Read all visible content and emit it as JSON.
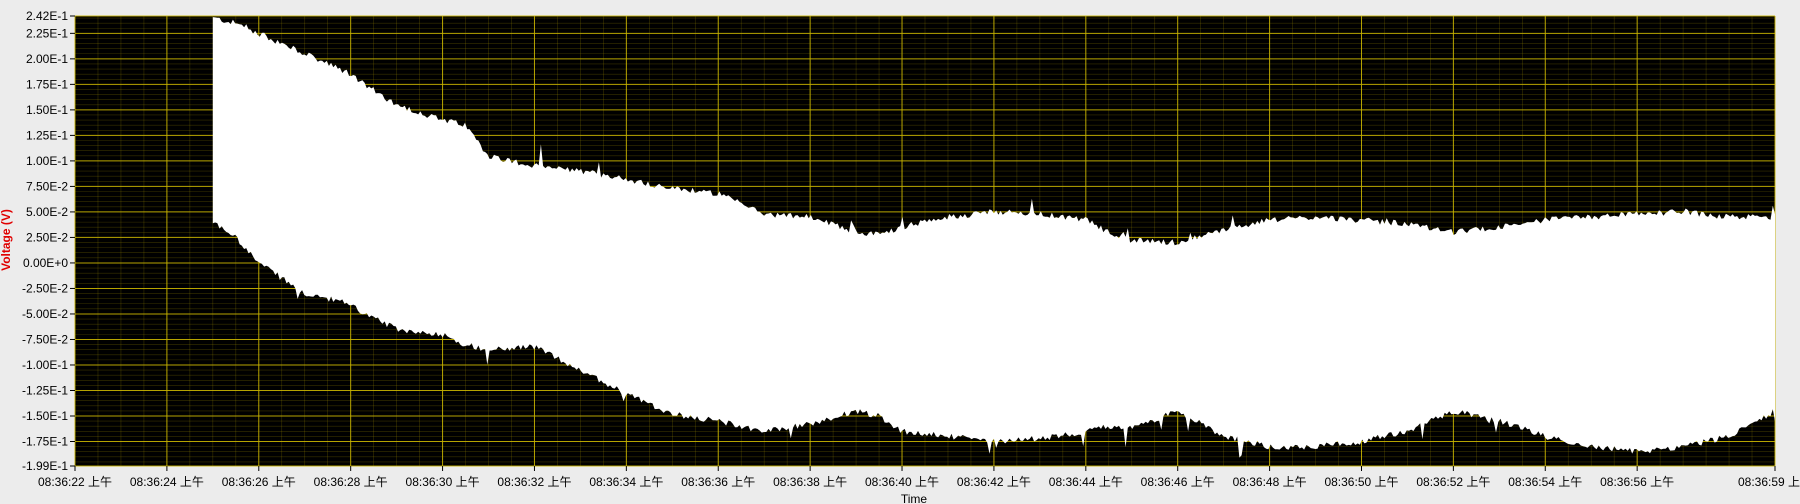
{
  "chart_data": {
    "type": "area",
    "xlabel": "Time",
    "ylabel": "Voltage (V)",
    "ylim": [
      -0.199,
      0.242
    ],
    "y_tick_values": [
      0.242,
      0.225,
      0.2,
      0.175,
      0.15,
      0.125,
      0.1,
      0.075,
      0.05,
      0.025,
      0.0,
      -0.025,
      -0.05,
      -0.075,
      -0.1,
      -0.125,
      -0.15,
      -0.175,
      -0.199
    ],
    "y_tick_labels": [
      "2.42E-1",
      "2.25E-1",
      "2.00E-1",
      "1.75E-1",
      "1.50E-1",
      "1.25E-1",
      "1.00E-1",
      "7.50E-2",
      "5.00E-2",
      "2.50E-2",
      "0.00E+0",
      "-2.50E-2",
      "-5.00E-2",
      "-7.50E-2",
      "-1.00E-1",
      "-1.25E-1",
      "-1.50E-1",
      "-1.75E-1",
      "-1.99E-1"
    ],
    "xlim": [
      0,
      37
    ],
    "x_tick_values": [
      0,
      2,
      4,
      6,
      8,
      10,
      12,
      14,
      16,
      18,
      20,
      22,
      24,
      26,
      28,
      30,
      32,
      34,
      37
    ],
    "x_tick_labels": [
      "08:36:22 上午",
      "08:36:24 上午",
      "08:36:26 上午",
      "08:36:28 上午",
      "08:36:30 上午",
      "08:36:32 上午",
      "08:36:34 上午",
      "08:36:36 上午",
      "08:36:38 上午",
      "08:36:40 上午",
      "08:36:42 上午",
      "08:36:44 上午",
      "08:36:46 上午",
      "08:36:48 上午",
      "08:36:50 上午",
      "08:36:52 上午",
      "08:36:54 上午",
      "08:36:56 上午",
      "08:36:59 上午"
    ],
    "grid": true,
    "colors": {
      "plot_background": "#000000",
      "signal": "#ffffff",
      "grid": "#c8b400",
      "ylabel": "#e00000",
      "frame": "#ececec"
    },
    "series": [
      {
        "style": "envelope",
        "x": [
          3.0,
          3.5,
          4.0,
          5.0,
          6.0,
          6.3,
          7.0,
          8.0,
          8.5,
          9.0,
          10.0,
          11.0,
          12.0,
          13.0,
          14.0,
          15.0,
          16.0,
          17.0,
          17.5,
          18.0,
          19.0,
          20.0,
          21.0,
          22.0,
          22.5,
          23.0,
          24.0,
          25.0,
          26.0,
          27.0,
          28.0,
          29.0,
          30.0,
          31.0,
          32.0,
          33.0,
          34.0,
          35.0,
          36.0,
          37.0
        ],
        "upper": [
          0.24,
          0.235,
          0.225,
          0.205,
          0.185,
          0.175,
          0.155,
          0.14,
          0.135,
          0.105,
          0.095,
          0.09,
          0.082,
          0.073,
          0.068,
          0.048,
          0.045,
          0.03,
          0.028,
          0.035,
          0.045,
          0.05,
          0.048,
          0.042,
          0.03,
          0.022,
          0.02,
          0.032,
          0.042,
          0.045,
          0.042,
          0.038,
          0.03,
          0.035,
          0.042,
          0.045,
          0.048,
          0.05,
          0.045,
          0.045
        ],
        "lower": [
          0.04,
          0.025,
          0.0,
          -0.03,
          -0.04,
          -0.05,
          -0.065,
          -0.07,
          -0.08,
          -0.085,
          -0.082,
          -0.105,
          -0.128,
          -0.148,
          -0.155,
          -0.165,
          -0.158,
          -0.145,
          -0.15,
          -0.165,
          -0.17,
          -0.175,
          -0.172,
          -0.165,
          -0.16,
          -0.162,
          -0.145,
          -0.17,
          -0.18,
          -0.18,
          -0.175,
          -0.165,
          -0.145,
          -0.155,
          -0.17,
          -0.18,
          -0.185,
          -0.18,
          -0.17,
          -0.145
        ]
      }
    ]
  }
}
